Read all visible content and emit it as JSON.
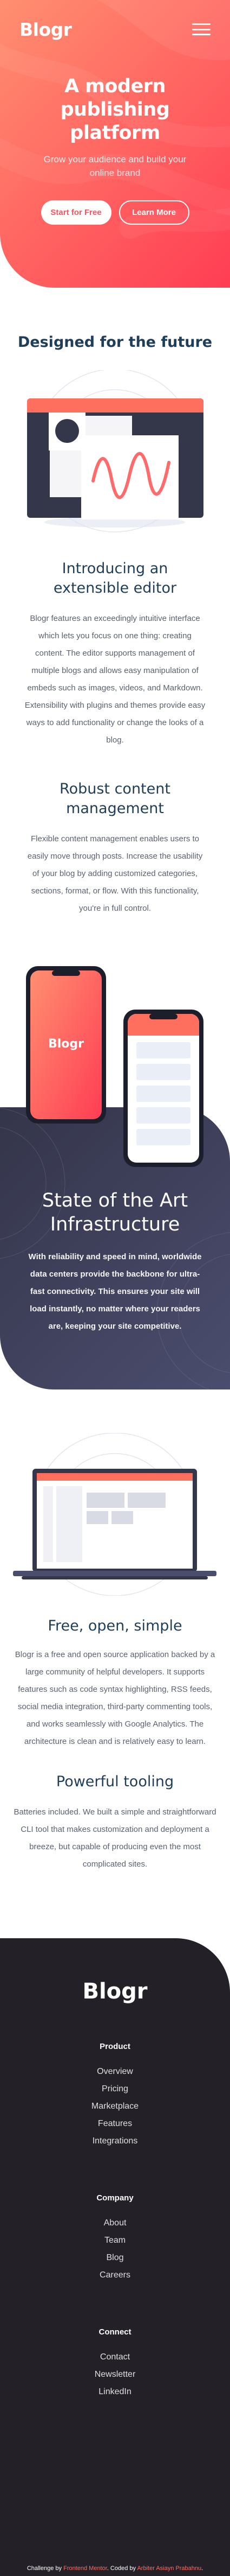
{
  "header": {
    "logo": "Blogr",
    "menu_icon": "hamburger-icon"
  },
  "hero": {
    "title": "A modern publishing platform",
    "subtitle": "Grow your audience and build your online brand",
    "primary_button": "Start for Free",
    "secondary_button": "Learn More",
    "gradient_start": "#ff8f70",
    "gradient_end": "#ff3d54"
  },
  "future": {
    "heading": "Designed for the future",
    "features": [
      {
        "title": "Introducing an extensible editor",
        "text": "Blogr features an exceedingly intuitive interface which lets you focus on one thing: creating content. The editor supports management of multiple blogs and allows easy manipulation of embeds such as images, videos, and Markdown. Extensibility with plugins and themes provide easy ways to add functionality or change the looks of a blog."
      },
      {
        "title": "Robust content management",
        "text": "Flexible content management enables users to easily move through posts. Increase the usability of your blog by adding customized categories, sections, format, or flow. With this functionality, you're in full control."
      }
    ]
  },
  "infrastructure": {
    "phone_logo": "Blogr",
    "title": "State of the Art Infrastructure",
    "text": "With reliability and speed in mind, worldwide data centers provide the backbone for ultra-fast connectivity. This ensures your site will load instantly, no matter where your readers are, keeping your site competitive."
  },
  "free": {
    "features": [
      {
        "title": "Free, open, simple",
        "text": "Blogr is a free and open source application backed by a large community of helpful developers. It supports features such as code syntax highlighting, RSS feeds, social media integration, third-party commenting tools, and works seamlessly with Google Analytics. The architecture is clean and is relatively easy to learn."
      },
      {
        "title": "Powerful tooling",
        "text": "Batteries included. We built a simple and straightforward CLI tool that makes customization and deployment a breeze, but capable of producing even the most complicated sites."
      }
    ]
  },
  "footer": {
    "logo": "Blogr",
    "columns": [
      {
        "title": "Product",
        "links": [
          "Overview",
          "Pricing",
          "Marketplace",
          "Features",
          "Integrations"
        ]
      },
      {
        "title": "Company",
        "links": [
          "About",
          "Team",
          "Blog",
          "Careers"
        ]
      },
      {
        "title": "Connect",
        "links": [
          "Contact",
          "Newsletter",
          "LinkedIn"
        ]
      }
    ],
    "attribution": {
      "prefix": "Challenge by ",
      "challenge_link": "Frontend Mentor",
      "middle": ". Coded by ",
      "coder_link": "Arbiter Asiayn Prabahnu",
      "suffix": "."
    }
  },
  "colors": {
    "heading_text": "#1f3e5a",
    "body_text": "#5a6270",
    "accent_red": "#ff525d",
    "dark_bg": "#232127",
    "infra_bg_start": "#34354a",
    "infra_bg_end": "#4b4d6e"
  }
}
